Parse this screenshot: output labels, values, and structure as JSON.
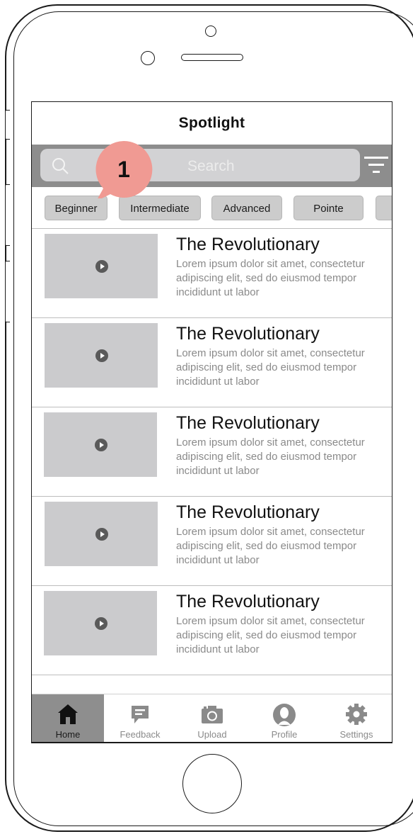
{
  "app": {
    "title": "Spotlight"
  },
  "search": {
    "placeholder": "Search"
  },
  "filters": [
    "Beginner",
    "Intermediate",
    "Advanced",
    "Pointe",
    ""
  ],
  "items": [
    {
      "title": "The Revolutionary",
      "desc": "Lorem ipsum dolor sit amet, consectetur adipiscing elit, sed do eiusmod tempor incididunt ut labor"
    },
    {
      "title": "The Revolutionary",
      "desc": "Lorem ipsum dolor sit amet, consectetur adipiscing elit, sed do eiusmod tempor incididunt ut labor"
    },
    {
      "title": "The Revolutionary",
      "desc": "Lorem ipsum dolor sit amet, consectetur adipiscing elit, sed do eiusmod tempor incididunt ut labor"
    },
    {
      "title": "The Revolutionary",
      "desc": "Lorem ipsum dolor sit amet, consectetur adipiscing elit, sed do eiusmod tempor incididunt ut labor"
    },
    {
      "title": "The Revolutionary",
      "desc": "Lorem ipsum dolor sit amet, consectetur adipiscing elit, sed do eiusmod tempor incididunt ut labor"
    }
  ],
  "tabs": [
    {
      "label": "Home",
      "icon": "home-icon",
      "active": true
    },
    {
      "label": "Feedback",
      "icon": "feedback-icon",
      "active": false
    },
    {
      "label": "Upload",
      "icon": "camera-icon",
      "active": false
    },
    {
      "label": "Profile",
      "icon": "profile-icon",
      "active": false
    },
    {
      "label": "Settings",
      "icon": "gear-icon",
      "active": false
    }
  ],
  "annotation": {
    "number": "1",
    "color": "#f09a93"
  }
}
